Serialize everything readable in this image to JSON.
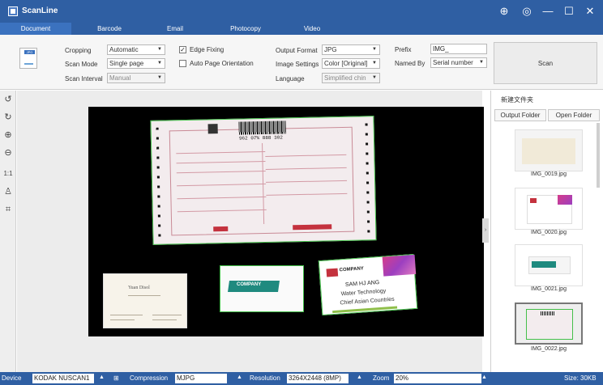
{
  "app": {
    "title": "ScanLine"
  },
  "window_controls": {
    "settings": "⊕",
    "help": "◎",
    "minimize": "—",
    "maximize": "☐",
    "close": "✕"
  },
  "tabs": [
    {
      "label": "Document",
      "active": true
    },
    {
      "label": "Barcode",
      "active": false
    },
    {
      "label": "Email",
      "active": false
    },
    {
      "label": "Photocopy",
      "active": false
    },
    {
      "label": "Video",
      "active": false
    }
  ],
  "options": {
    "cropping_label": "Cropping",
    "cropping_value": "Automatic",
    "scan_mode_label": "Scan Mode",
    "scan_mode_value": "Single page",
    "scan_interval_label": "Scan Interval",
    "scan_interval_value": "Manual",
    "edge_fixing_label": "Edge Fixing",
    "edge_fixing_checked": true,
    "auto_orientation_label": "Auto Page Orientation",
    "auto_orientation_checked": false,
    "output_format_label": "Output Format",
    "output_format_value": "JPG",
    "image_settings_label": "Image Settings",
    "image_settings_value": "Color [Original]",
    "language_label": "Language",
    "language_value": "Simplified chin",
    "prefix_label": "Prefix",
    "prefix_value": "IMG_",
    "named_by_label": "Named By",
    "named_by_value": "Serial number",
    "thumb_tag": "JPG",
    "scan_button": "Scan"
  },
  "tools": [
    {
      "name": "rotate-left-icon",
      "glyph": "↺"
    },
    {
      "name": "rotate-right-icon",
      "glyph": "↻"
    },
    {
      "name": "zoom-in-icon",
      "glyph": "⊕"
    },
    {
      "name": "zoom-out-icon",
      "glyph": "⊖"
    },
    {
      "name": "actual-size-icon",
      "glyph": "1:1"
    },
    {
      "name": "stamp-icon",
      "glyph": "♙"
    },
    {
      "name": "crop-icon",
      "glyph": "⌗"
    }
  ],
  "preview": {
    "barcode_text": "962 07% 888 302",
    "card1_name": "Yuan Disol",
    "card3_brand": "COMPANY",
    "card3_name": "SAM HJ ANG",
    "card3_title": "Water Technology",
    "card3_sub": "Chief Asian Countries",
    "card2_brand": "COMPANY"
  },
  "right_panel": {
    "folder_name": "新建文件夹",
    "output_folder_button": "Output Folder",
    "open_folder_button": "Open Folder",
    "files": [
      {
        "name": "IMG_0019.jpg"
      },
      {
        "name": "IMG_0020.jpg"
      },
      {
        "name": "IMG_0021.jpg"
      },
      {
        "name": "IMG_0022.jpg"
      }
    ]
  },
  "status": {
    "device_label": "Device",
    "device_value": "KODAK NUSCAN1",
    "compression_label": "Compression",
    "compression_value": "MJPG",
    "resolution_label": "Resolution",
    "resolution_value": "3264X2448 (8MP)",
    "zoom_label": "Zoom",
    "zoom_value": "20%",
    "size_text": "Size: 30KB"
  },
  "colors": {
    "titlebar": "#2f5fa3",
    "active_tab": "#3b72bf",
    "crop_border": "#44c04a",
    "preview_bg": "#000000"
  }
}
